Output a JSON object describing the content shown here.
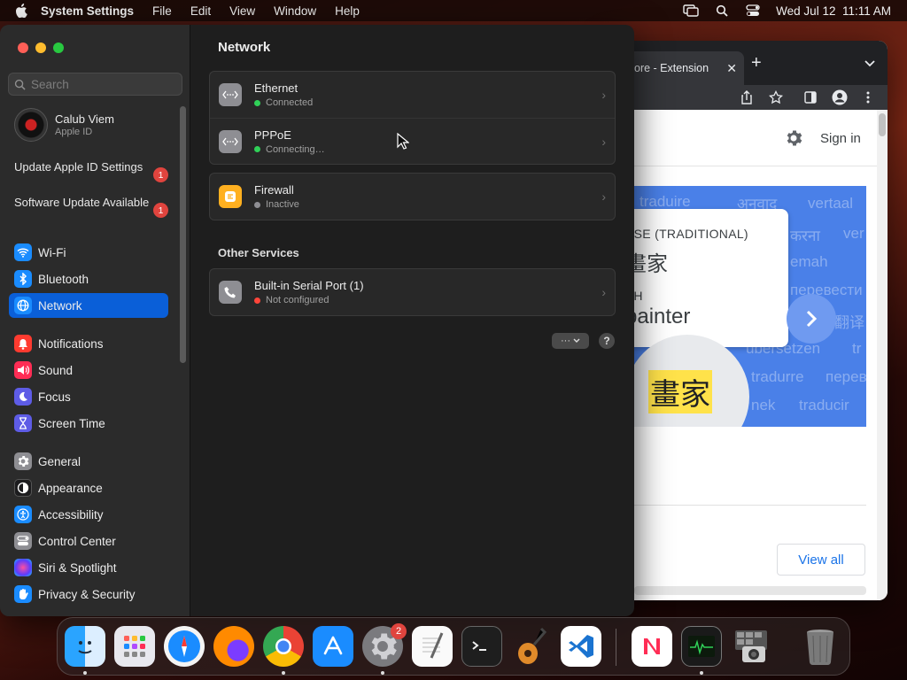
{
  "menubar": {
    "app_name": "System Settings",
    "menus": [
      "File",
      "Edit",
      "View",
      "Window",
      "Help"
    ],
    "clock": "Wed Jul 12  11:11 AM"
  },
  "browser": {
    "tab_title": "ore - Extension",
    "sign_in": "Sign in",
    "banner": {
      "lang1": "ESE (TRADITIONAL)",
      "word1": "畫家",
      "lang2": "SH",
      "word2": "painter",
      "highlight": "畫家",
      "bg_words": [
        "traduire",
        "अनुवाद",
        "vertaal",
        "ver",
        "करना",
        "emah",
        "перевести",
        "переве",
        "翻译",
        "übersetzen",
        "tr",
        "tradurre",
        "nek",
        "traducir"
      ]
    },
    "view_all": "View all"
  },
  "settings": {
    "search_placeholder": "Search",
    "account": {
      "name": "Calub Viem",
      "subtitle": "Apple ID"
    },
    "notices": [
      {
        "label": "Update Apple ID Settings",
        "badge": "1"
      },
      {
        "label": "Software Update Available",
        "badge": "1"
      }
    ],
    "nav": [
      {
        "id": "wifi",
        "label": "Wi-Fi",
        "icon": "wifi-icon",
        "color": "#1a8cff"
      },
      {
        "id": "bluetooth",
        "label": "Bluetooth",
        "icon": "bluetooth-icon",
        "color": "#1a8cff"
      },
      {
        "id": "network",
        "label": "Network",
        "icon": "globe-icon",
        "color": "#1a8cff",
        "active": true
      },
      {
        "id": "notifications",
        "label": "Notifications",
        "icon": "bell-icon",
        "color": "#ff3b30"
      },
      {
        "id": "sound",
        "label": "Sound",
        "icon": "speaker-icon",
        "color": "#ff2d55"
      },
      {
        "id": "focus",
        "label": "Focus",
        "icon": "moon-icon",
        "color": "#5e5ce6"
      },
      {
        "id": "screen-time",
        "label": "Screen Time",
        "icon": "hourglass-icon",
        "color": "#5e5ce6"
      },
      {
        "id": "general",
        "label": "General",
        "icon": "gear-icon",
        "color": "#8e8e93"
      },
      {
        "id": "appearance",
        "label": "Appearance",
        "icon": "appearance-icon",
        "color": "#1c1c1e"
      },
      {
        "id": "accessibility",
        "label": "Accessibility",
        "icon": "accessibility-icon",
        "color": "#1a8cff"
      },
      {
        "id": "control-center",
        "label": "Control Center",
        "icon": "control-center-icon",
        "color": "#8e8e93"
      },
      {
        "id": "siri",
        "label": "Siri & Spotlight",
        "icon": "siri-icon",
        "color": "#b04cff"
      },
      {
        "id": "privacy",
        "label": "Privacy & Security",
        "icon": "hand-icon",
        "color": "#1a8cff"
      }
    ],
    "main": {
      "title": "Network",
      "services": [
        {
          "name": "Ethernet",
          "status": "Connected",
          "status_color": "#30d158",
          "icon": "ethernet-icon"
        },
        {
          "name": "PPPoE",
          "status": "Connecting…",
          "status_color": "#30d158",
          "icon": "ethernet-icon"
        }
      ],
      "firewall": {
        "name": "Firewall",
        "status": "Inactive",
        "status_color": "#8e8e93",
        "icon": "firewall-icon"
      },
      "other_title": "Other Services",
      "other": [
        {
          "name": "Built-in Serial Port (1)",
          "status": "Not configured",
          "status_color": "#ff453a",
          "icon": "phone-icon"
        }
      ],
      "more_label": "···",
      "help_label": "?"
    }
  },
  "dock": {
    "apps": [
      "Finder",
      "Launchpad",
      "Safari",
      "Firefox",
      "Chrome",
      "App Store",
      "System Settings",
      "TextEdit",
      "Terminal",
      "GarageBand",
      "Visual Studio Code",
      "News",
      "Activity Monitor",
      "Screenshot",
      "Trash"
    ],
    "settings_badge": "2"
  }
}
